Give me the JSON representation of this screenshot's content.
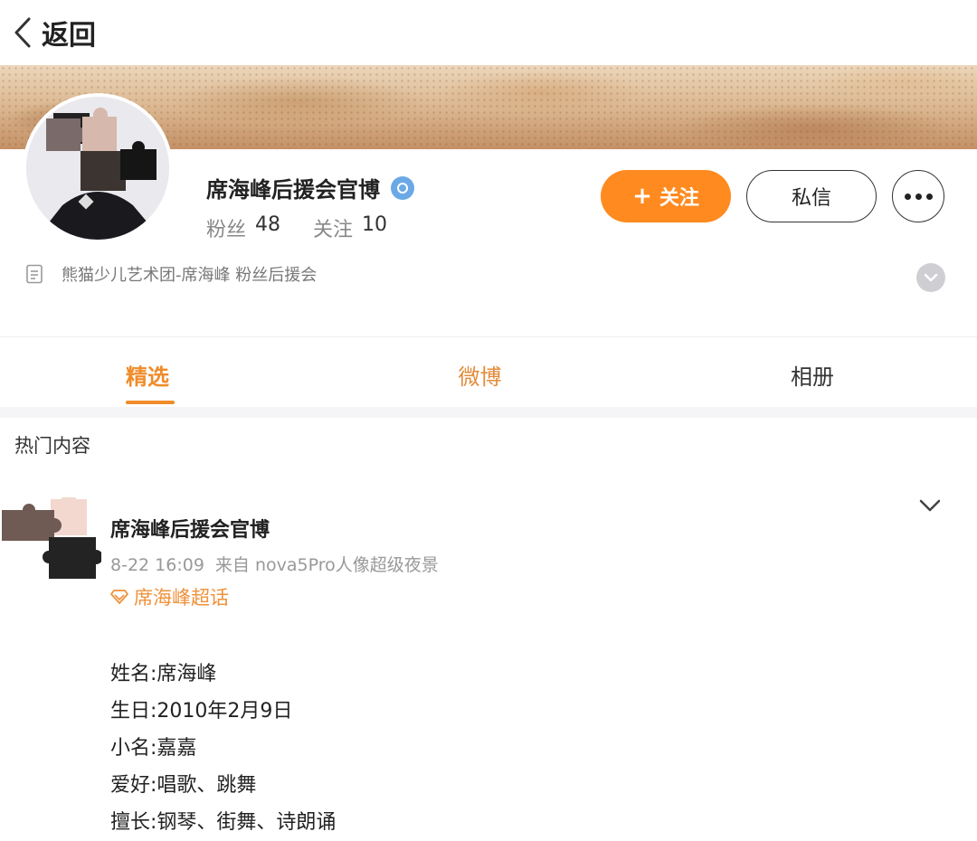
{
  "nav": {
    "back_label": "返回"
  },
  "profile": {
    "name": "席海峰后援会官博",
    "fans_label": "粉丝",
    "fans_count": "48",
    "following_label": "关注",
    "following_count": "10",
    "follow_button": "关注",
    "message_button": "私信",
    "bio": "熊猫少儿艺术团-席海峰 粉丝后援会"
  },
  "tabs": [
    {
      "label": "精选",
      "active": true
    },
    {
      "label": "微博",
      "active": false
    },
    {
      "label": "相册",
      "active": false
    }
  ],
  "section": {
    "title": "热门内容"
  },
  "post": {
    "author": "席海峰后援会官博",
    "time": "8-22 16:09",
    "source": "来自 nova5Pro人像超级夜景",
    "topic": "席海峰超话",
    "lines": [
      "姓名:席海峰",
      "生日:2010年2月9日",
      "小名:嘉嘉",
      "爱好:唱歌、跳舞",
      "擅长:钢琴、街舞、诗朗诵"
    ]
  },
  "colors": {
    "accent_orange": "#ff8a1f",
    "tab_active": "#f08b2a",
    "verify_blue": "#6aa9e6"
  }
}
